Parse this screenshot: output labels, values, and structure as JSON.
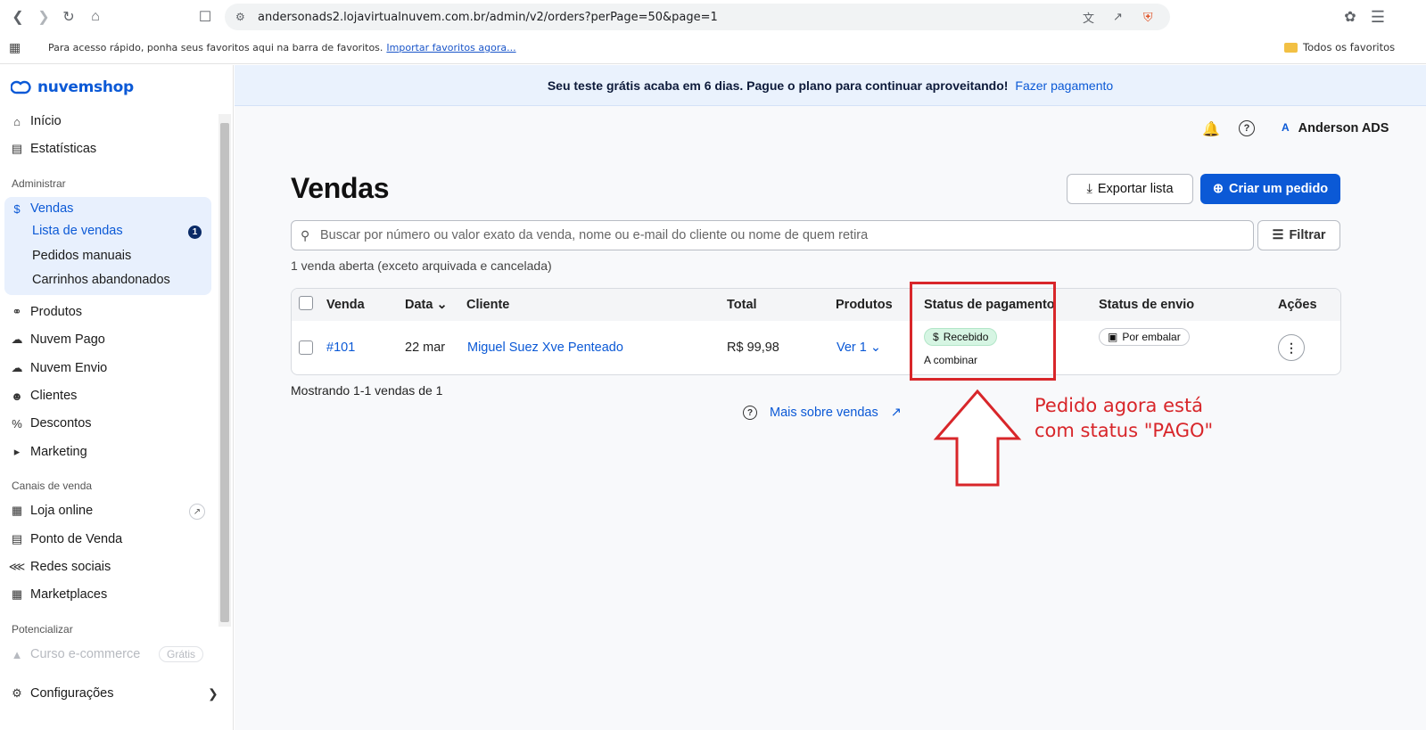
{
  "browser": {
    "url": "andersonads2.lojavirtualnuvem.com.br/admin/v2/orders?perPage=50&page=1",
    "bookmarks_tip": "Para acesso rápido, ponha seus favoritos aqui na barra de favoritos.",
    "bookmarks_link": "Importar favoritos agora...",
    "all_bookmarks": "Todos os favoritos"
  },
  "sidebar": {
    "logo": "nuvemshop",
    "home": "Início",
    "stats": "Estatísticas",
    "section_admin": "Administrar",
    "vendas": "Vendas",
    "sub_lista": "Lista de vendas",
    "sub_badge": "1",
    "sub_pedidos": "Pedidos manuais",
    "sub_carrinhos": "Carrinhos abandonados",
    "produtos": "Produtos",
    "nuvem_pago": "Nuvem Pago",
    "nuvem_envio": "Nuvem Envio",
    "clientes": "Clientes",
    "descontos": "Descontos",
    "marketing": "Marketing",
    "section_canais": "Canais de venda",
    "loja_online": "Loja online",
    "ponto_venda": "Ponto de Venda",
    "redes_sociais": "Redes sociais",
    "marketplaces": "Marketplaces",
    "section_potencializar": "Potencializar",
    "curso": "Curso e-commerce",
    "curso_badge": "Grátis",
    "config": "Configurações"
  },
  "trial": {
    "message": "Seu teste grátis acaba em 6 dias. Pague o plano para continuar aproveitando!",
    "link": "Fazer pagamento"
  },
  "header": {
    "user_initial": "A",
    "user_name": "Anderson ADS"
  },
  "page": {
    "title": "Vendas",
    "export_label": "Exportar lista",
    "create_label": "Criar um pedido",
    "search_placeholder": "Buscar por número ou valor exato da venda, nome ou e-mail do cliente ou nome de quem retira",
    "filter_label": "Filtrar",
    "count_text": "1 venda aberta (exceto arquivada e cancelada)",
    "showing_text": "Mostrando 1-1 vendas de 1",
    "more_link": "Mais sobre vendas"
  },
  "table": {
    "headers": [
      "Venda",
      "Data",
      "Cliente",
      "Total",
      "Produtos",
      "Status de pagamento",
      "Status de envio",
      "Ações"
    ],
    "row": {
      "id": "#101",
      "date": "22 mar",
      "client": "Miguel Suez Xve Penteado",
      "total": "R$ 99,98",
      "products": "Ver 1",
      "payment_status": "Recebido",
      "payment_method": "A combinar",
      "shipping_status": "Por embalar"
    }
  },
  "annotation": {
    "line1": "Pedido agora está",
    "line2": "com status \"PAGO\""
  }
}
